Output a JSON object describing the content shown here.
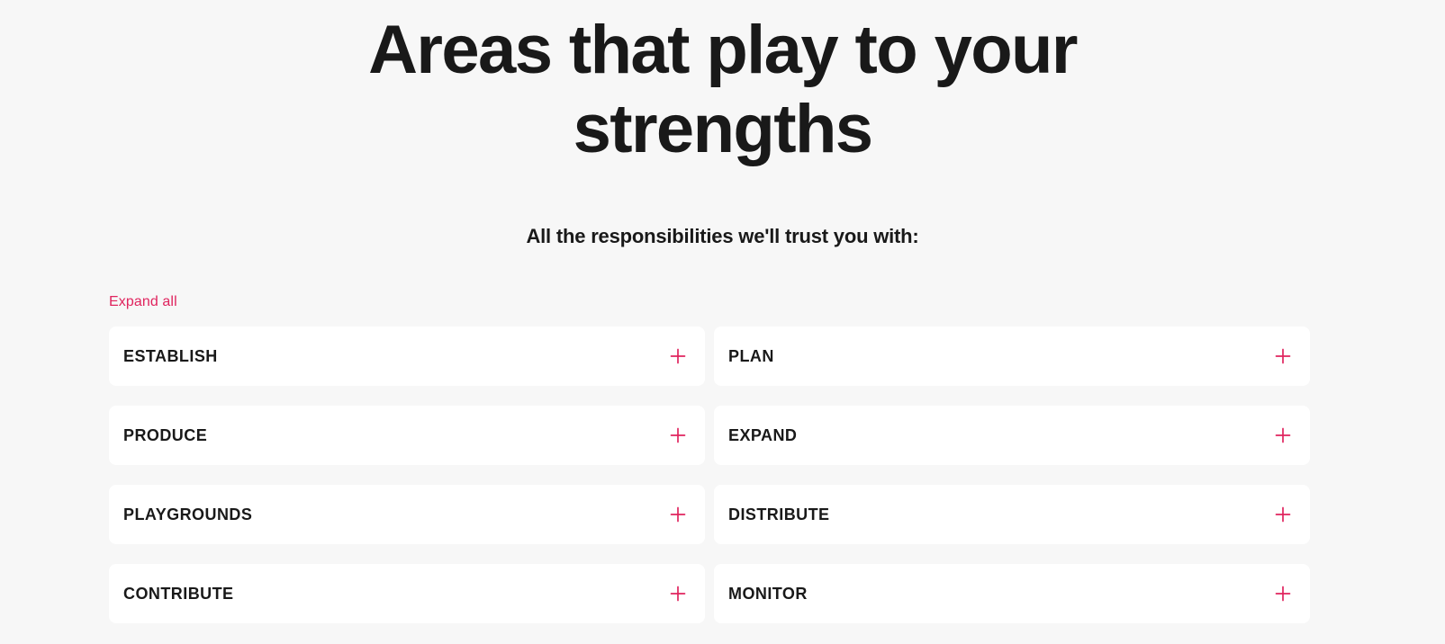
{
  "page": {
    "background_color": "#f7f7f7",
    "accent_color": "#e0245e",
    "text_color": "#191919",
    "card_color": "#ffffff"
  },
  "header": {
    "title": "Areas that play to your strengths",
    "subtitle": "All the responsibilities we'll trust you with:"
  },
  "controls": {
    "expand_all_label": "Expand all"
  },
  "accordion": {
    "plus_icon_name": "plus-icon",
    "items": [
      {
        "label": "ESTABLISH",
        "expanded": false,
        "column": "left",
        "row": 1
      },
      {
        "label": "PLAN",
        "expanded": false,
        "column": "right",
        "row": 1
      },
      {
        "label": "PRODUCE",
        "expanded": false,
        "column": "left",
        "row": 2
      },
      {
        "label": "EXPAND",
        "expanded": false,
        "column": "right",
        "row": 2
      },
      {
        "label": "PLAYGROUNDS",
        "expanded": false,
        "column": "left",
        "row": 3
      },
      {
        "label": "DISTRIBUTE",
        "expanded": false,
        "column": "right",
        "row": 3
      },
      {
        "label": "CONTRIBUTE",
        "expanded": false,
        "column": "left",
        "row": 4
      },
      {
        "label": "MONITOR",
        "expanded": false,
        "column": "right",
        "row": 4
      }
    ]
  }
}
